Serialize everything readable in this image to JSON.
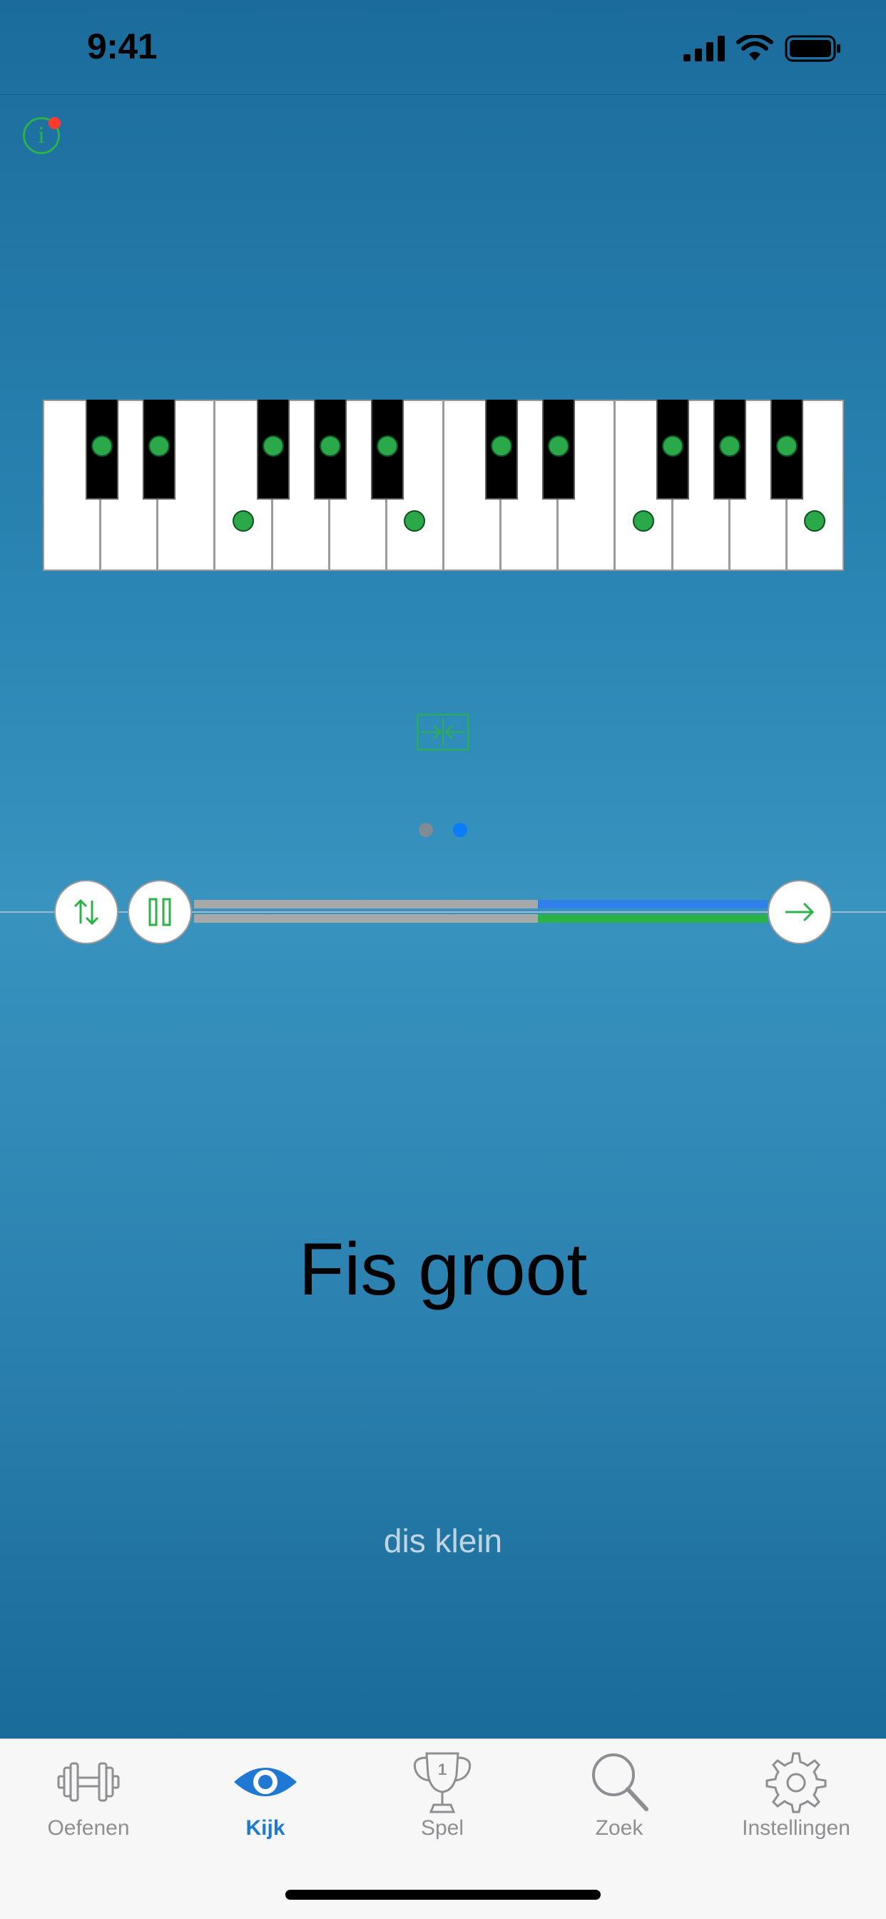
{
  "status_bar": {
    "time": "9:41"
  },
  "piano": {
    "white_key_count": 14,
    "black_key_count": 10,
    "marked_black_keys": [
      1,
      2,
      3,
      4,
      5,
      6,
      7,
      8,
      9,
      10
    ],
    "marked_white_keys": [
      4,
      7,
      11,
      14
    ],
    "marker_color": "#2aa84a"
  },
  "pager": {
    "page_count": 2,
    "active_page": 2,
    "inactive_color": "#7f8c95",
    "active_color": "#0a7cff"
  },
  "player": {
    "progress_blue": 0.4,
    "progress_green": 0.4,
    "blue_color": "#2f80e8",
    "green_color": "#2bb34a"
  },
  "chord": {
    "name": "Fis groot",
    "relative": "dis klein"
  },
  "tabs": [
    {
      "label": "Oefenen",
      "icon": "dumbbell-icon",
      "active": false
    },
    {
      "label": "Kijk",
      "icon": "eye-icon",
      "active": true
    },
    {
      "label": "Spel",
      "icon": "trophy-icon",
      "active": false
    },
    {
      "label": "Zoek",
      "icon": "magnifier-icon",
      "active": false
    },
    {
      "label": "Instellingen",
      "icon": "gear-icon",
      "active": false
    }
  ],
  "colors": {
    "accent_green": "#2bb34a",
    "tab_active": "#1f78d1",
    "tab_inactive": "#8e8e93",
    "notification_dot": "#ff3b30"
  }
}
